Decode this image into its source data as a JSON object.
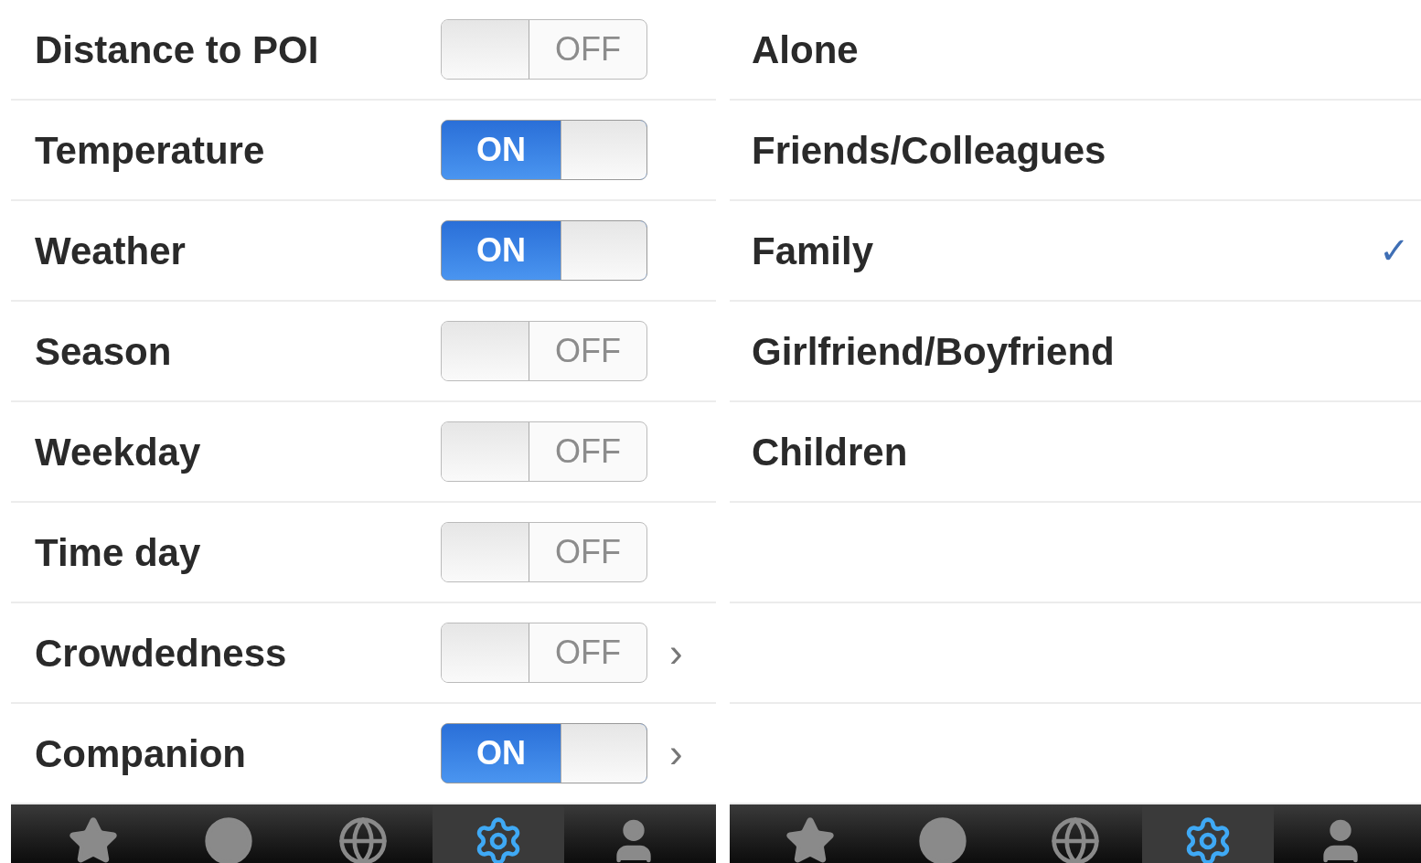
{
  "settings": {
    "rows": [
      {
        "label": "Distance to POI",
        "on": false,
        "toggle_text": "OFF"
      },
      {
        "label": "Temperature",
        "on": true,
        "toggle_text": "ON"
      },
      {
        "label": "Weather",
        "on": true,
        "toggle_text": "ON"
      },
      {
        "label": "Season",
        "on": false,
        "toggle_text": "OFF"
      },
      {
        "label": "Weekday",
        "on": false,
        "toggle_text": "OFF"
      },
      {
        "label": "Time day",
        "on": false,
        "toggle_text": "OFF"
      },
      {
        "label": "Crowdedness",
        "on": false,
        "toggle_text": "OFF",
        "chevron_text": "›"
      },
      {
        "label": "Companion",
        "on": true,
        "toggle_text": "ON",
        "chevron_text": "›"
      }
    ],
    "tab_bar": [
      {
        "kind": "star",
        "selected": false
      },
      {
        "kind": "circle",
        "selected": false
      },
      {
        "kind": "globe",
        "selected": false
      },
      {
        "kind": "gear",
        "selected": true
      },
      {
        "kind": "person",
        "selected": false
      }
    ]
  },
  "companion": {
    "options": [
      {
        "label": "Alone",
        "selected": false
      },
      {
        "label": "Friends/Colleagues",
        "selected": false
      },
      {
        "label": "Family",
        "selected": true
      },
      {
        "label": "Girlfriend/Boyfriend",
        "selected": false
      },
      {
        "label": "Children",
        "selected": false
      }
    ],
    "check_text": "✓",
    "tab_bar": [
      {
        "kind": "star",
        "selected": false
      },
      {
        "kind": "circle",
        "selected": false
      },
      {
        "kind": "globe",
        "selected": false
      },
      {
        "kind": "gear",
        "selected": true
      },
      {
        "kind": "person",
        "selected": false
      }
    ]
  }
}
